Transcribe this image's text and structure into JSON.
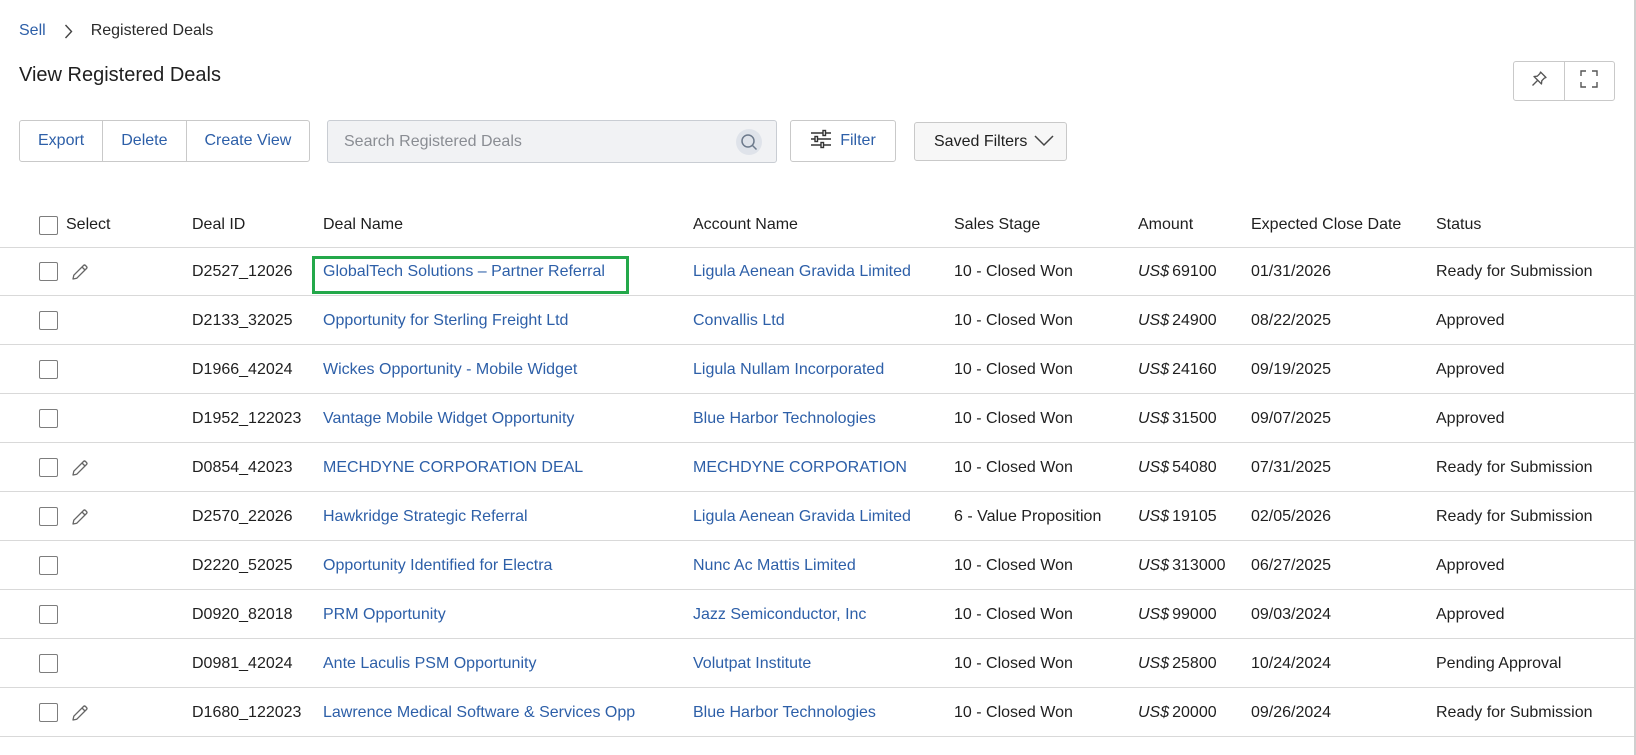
{
  "breadcrumb": {
    "parent": "Sell",
    "current": "Registered Deals"
  },
  "page_title": "View Registered Deals",
  "toolbar": {
    "export": "Export",
    "delete": "Delete",
    "create_view": "Create View"
  },
  "search": {
    "placeholder": "Search Registered Deals",
    "value": ""
  },
  "filter_label": "Filter",
  "saved_filters_label": "Saved Filters",
  "columns": {
    "select": "Select",
    "deal_id": "Deal ID",
    "deal_name": "Deal Name",
    "account_name": "Account Name",
    "sales_stage": "Sales Stage",
    "amount": "Amount",
    "close_date": "Expected Close Date",
    "status": "Status"
  },
  "rows": [
    {
      "deal_id": "D2527_12026",
      "deal_name": "GlobalTech Solutions – Partner Referral",
      "account": "Ligula Aenean Gravida Limited",
      "stage": "10 - Closed Won",
      "currency": "US$",
      "amount": "69100",
      "close_date": "01/31/2026",
      "status": "Ready for Submission",
      "editable": true
    },
    {
      "deal_id": "D2133_32025",
      "deal_name": "Opportunity for Sterling Freight Ltd",
      "account": "Convallis Ltd",
      "stage": "10 - Closed Won",
      "currency": "US$",
      "amount": "24900",
      "close_date": "08/22/2025",
      "status": "Approved",
      "editable": false
    },
    {
      "deal_id": "D1966_42024",
      "deal_name": "Wickes Opportunity - Mobile Widget",
      "account": "Ligula Nullam Incorporated",
      "stage": "10 - Closed Won",
      "currency": "US$",
      "amount": "24160",
      "close_date": "09/19/2025",
      "status": "Approved",
      "editable": false
    },
    {
      "deal_id": "D1952_122023",
      "deal_name": "Vantage Mobile Widget Opportunity",
      "account": "Blue Harbor Technologies",
      "stage": "10 - Closed Won",
      "currency": "US$",
      "amount": "31500",
      "close_date": "09/07/2025",
      "status": "Approved",
      "editable": false
    },
    {
      "deal_id": "D0854_42023",
      "deal_name": "MECHDYNE CORPORATION DEAL",
      "account": "MECHDYNE CORPORATION",
      "stage": "10 - Closed Won",
      "currency": "US$",
      "amount": "54080",
      "close_date": "07/31/2025",
      "status": "Ready for Submission",
      "editable": true
    },
    {
      "deal_id": "D2570_22026",
      "deal_name": "Hawkridge Strategic Referral",
      "account": "Ligula Aenean Gravida Limited",
      "stage": "6 - Value Proposition",
      "currency": "US$",
      "amount": "19105",
      "close_date": "02/05/2026",
      "status": "Ready for Submission",
      "editable": true
    },
    {
      "deal_id": "D2220_52025",
      "deal_name": "Opportunity Identified for Electra",
      "account": "Nunc Ac Mattis Limited",
      "stage": "10 - Closed Won",
      "currency": "US$",
      "amount": "313000",
      "close_date": "06/27/2025",
      "status": "Approved",
      "editable": false
    },
    {
      "deal_id": "D0920_82018",
      "deal_name": "PRM Opportunity",
      "account": "Jazz Semiconductor, Inc",
      "stage": "10 - Closed Won",
      "currency": "US$",
      "amount": "99000",
      "close_date": "09/03/2024",
      "status": "Approved",
      "editable": false
    },
    {
      "deal_id": "D0981_42024",
      "deal_name": "Ante Laculis PSM Opportunity",
      "account": "Volutpat Institute",
      "stage": "10 - Closed Won",
      "currency": "US$",
      "amount": "25800",
      "close_date": "10/24/2024",
      "status": "Pending Approval",
      "editable": false
    },
    {
      "deal_id": "D1680_122023",
      "deal_name": "Lawrence Medical Software & Services Opp",
      "account": "Blue Harbor Technologies",
      "stage": "10 - Closed Won",
      "currency": "US$",
      "amount": "20000",
      "close_date": "09/26/2024",
      "status": "Ready for Submission",
      "editable": true
    }
  ],
  "icons": {
    "breadcrumb_separator": "chevron-right-icon",
    "pin": "pin-icon",
    "fullscreen": "fullscreen-icon",
    "search": "search-icon",
    "filter": "sliders-icon",
    "dropdown": "chevron-down-icon",
    "edit": "pencil-icon"
  },
  "colors": {
    "link": "#2d5fa8",
    "highlight_border": "#23a84a",
    "border": "#c9c9c9"
  }
}
